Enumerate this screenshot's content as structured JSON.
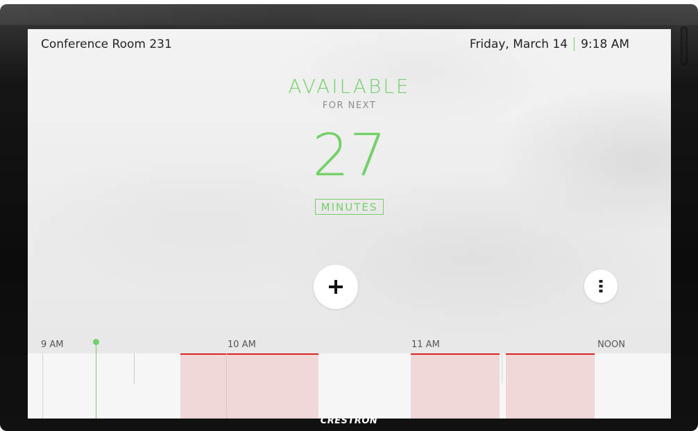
{
  "room": {
    "name": "Conference Room 231"
  },
  "clock": {
    "date": "Friday, March 14",
    "time": "9:18 AM"
  },
  "status": {
    "label": "AVAILABLE",
    "sub_label": "FOR NEXT",
    "value": "27",
    "unit": "MINUTES"
  },
  "actions": {
    "add_icon": "plus-icon",
    "more_icon": "more-vertical-icon"
  },
  "timeline": {
    "labels": [
      "9 AM",
      "10 AM",
      "11 AM",
      "NOON"
    ],
    "current_time": "9:18 AM",
    "bookings": [
      {
        "start": "9:30 AM",
        "end": "10:15 AM"
      },
      {
        "start": "11:00 AM",
        "end": "11:30 AM"
      },
      {
        "start": "11:30 AM",
        "end": "12:00 PM"
      }
    ]
  },
  "device": {
    "brand": "CRESTRON"
  },
  "colors": {
    "available": "#74d06a",
    "booked_fill": "#f0d8d8",
    "booked_border": "#e02020",
    "bezel": "#111111"
  }
}
